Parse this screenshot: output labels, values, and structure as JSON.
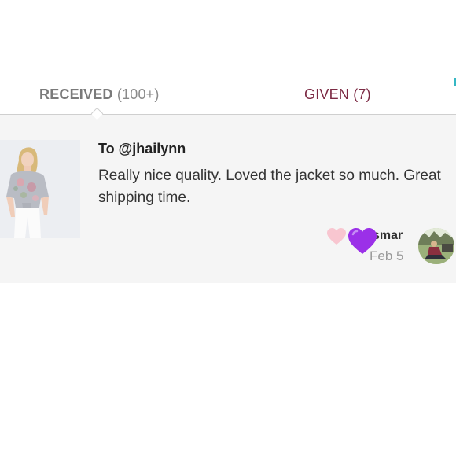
{
  "tabs": {
    "received_label": "RECEIVED",
    "received_count": "(100+)",
    "given_label": "GIVEN",
    "given_count": "(7)",
    "active": "received"
  },
  "review": {
    "to": "To @jhailynn",
    "body": "Really nice quality. Loved the jacket so much. Great shipping time.",
    "reviewer": "smar",
    "date": "Feb 5",
    "like_icon": "heart-outline-pink",
    "reaction_icon": "purple-heart-emoji"
  },
  "colors": {
    "given_tab": "#7c2a44",
    "received_tab": "#7a7a7a",
    "like_heart": "#f8c6d0",
    "purple_heart": "#9b30e8",
    "card_background": "#f5f5f5"
  }
}
